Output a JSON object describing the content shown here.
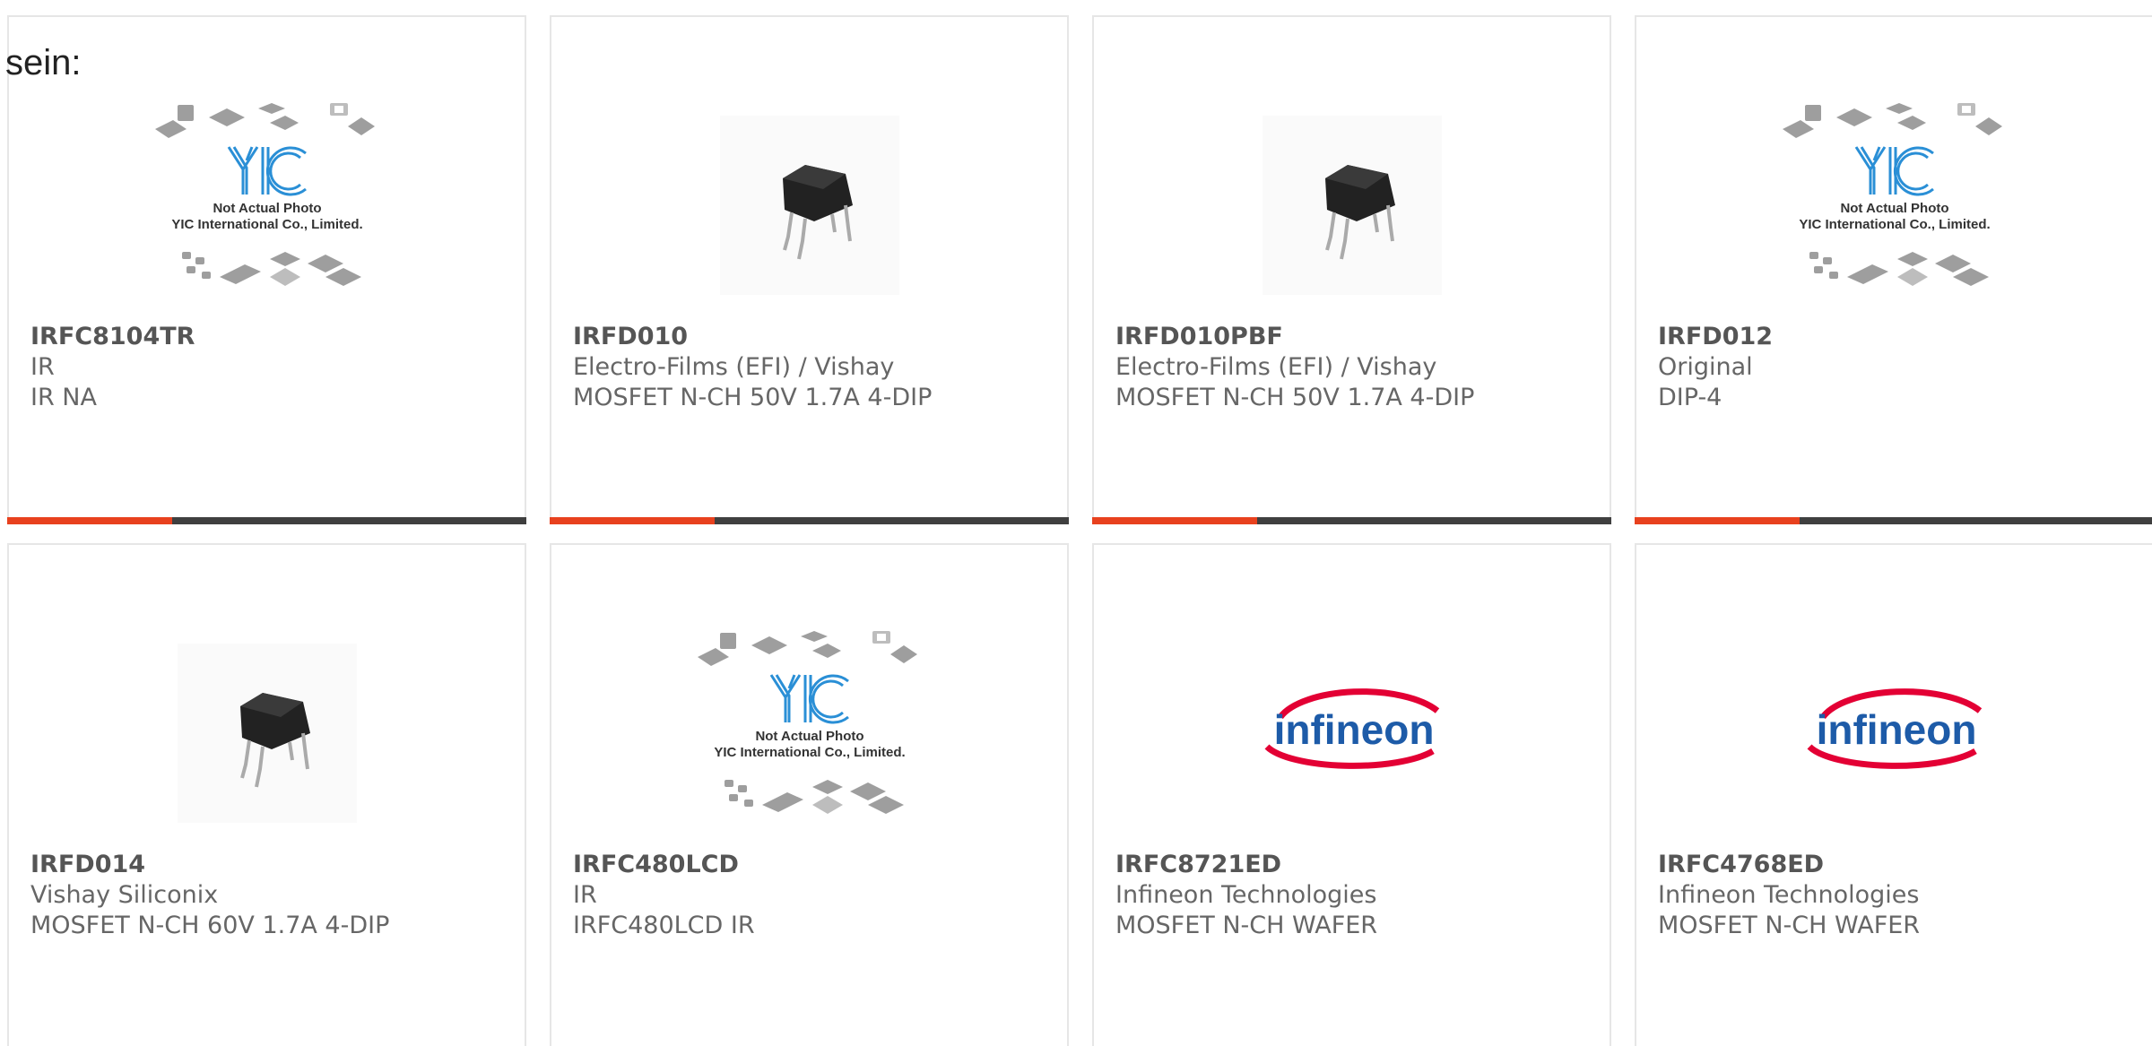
{
  "intro_text": "sein:",
  "colors": {
    "card_border": "#e6e6e6",
    "text": "#666666",
    "title": "#555555",
    "bar_dark": "#3f3f3f",
    "bar_accent": "#e8411e",
    "infineon_red": "#e30034",
    "infineon_blue": "#1d5ba8",
    "yic_blue": "#2a8fd6"
  },
  "placeholder_caption": {
    "line1": "Not Actual Photo",
    "line2": "YIC International Co., Limited."
  },
  "brand_logo_text": "infineon",
  "products": [
    {
      "part": "IRFC8104TR",
      "maker": "IR",
      "desc": "IR NA",
      "image": "placeholder"
    },
    {
      "part": "IRFD010",
      "maker": "Electro-Films (EFI) / Vishay",
      "desc": "MOSFET N-CH 50V 1.7A 4-DIP",
      "image": "dip-package"
    },
    {
      "part": "IRFD010PBF",
      "maker": "Electro-Films (EFI) / Vishay",
      "desc": "MOSFET N-CH 50V 1.7A 4-DIP",
      "image": "dip-package"
    },
    {
      "part": "IRFD012",
      "maker": "Original",
      "desc": "DIP-4",
      "image": "placeholder"
    },
    {
      "part": "IRFD014",
      "maker": "Vishay Siliconix",
      "desc": "MOSFET N-CH 60V 1.7A 4-DIP",
      "image": "dip-package"
    },
    {
      "part": "IRFC480LCD",
      "maker": "IR",
      "desc": "IRFC480LCD IR",
      "image": "placeholder"
    },
    {
      "part": "IRFC8721ED",
      "maker": "Infineon Technologies",
      "desc": "MOSFET N-CH WAFER",
      "image": "infineon-logo"
    },
    {
      "part": "IRFC4768ED",
      "maker": "Infineon Technologies",
      "desc": "MOSFET N-CH WAFER",
      "image": "infineon-logo"
    }
  ]
}
